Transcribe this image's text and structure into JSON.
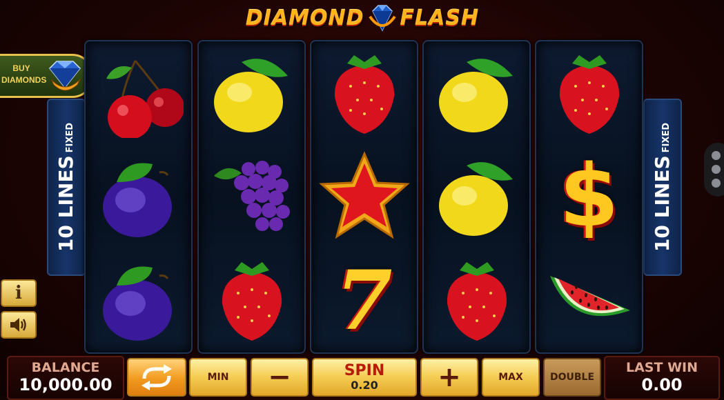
{
  "game": {
    "title_left": "DIAMOND",
    "title_right": "FLASH"
  },
  "buy_diamonds": {
    "label": "BUY DIAMONDS"
  },
  "lines_panel": {
    "main": "10 LINES",
    "sub": "FIXED"
  },
  "reels": [
    [
      "cherry",
      "plum",
      "plum"
    ],
    [
      "lemon",
      "grapes",
      "strawberry"
    ],
    [
      "strawberry",
      "star",
      "seven"
    ],
    [
      "lemon",
      "lemon",
      "strawberry"
    ],
    [
      "strawberry",
      "dollar",
      "watermelon"
    ]
  ],
  "seven_symbol_text": "7",
  "dollar_symbol_text": "$",
  "info_button": {
    "icon": "info-icon",
    "label": "i"
  },
  "sound_button": {
    "icon": "speaker-icon"
  },
  "bottom_bar": {
    "balance_label": "BALANCE",
    "balance_value": "10,000.00",
    "min_label": "MIN",
    "minus_label": "−",
    "spin_label": "SPIN",
    "bet_value": "0.20",
    "plus_label": "+",
    "max_label": "MAX",
    "double_label": "DOUBLE",
    "last_win_label": "LAST WIN",
    "last_win_value": "0.00"
  },
  "colors": {
    "background": "#1c0403",
    "reel_bg": "#07111f",
    "button_gold": "#f4cc52",
    "title_orange": "#ffb41e"
  }
}
